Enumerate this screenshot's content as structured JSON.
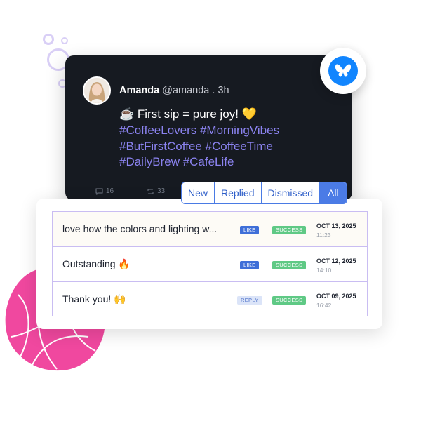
{
  "colors": {
    "card_dark": "#161a21",
    "hashtag": "#8b83f0",
    "accent_blue": "#4b7be6",
    "bluesky": "#1185fe",
    "success": "#5fc985",
    "blob_pink": "#f0489f",
    "table_border": "#c9bdf2"
  },
  "post": {
    "author_name": "Amanda",
    "author_meta": "@amanda . 3h",
    "line1": "☕ First sip = pure joy! 💛",
    "line2": "#CoffeeLovers #MorningVibes",
    "line3": "#ButFirstCoffee #CoffeeTime",
    "line4": "#DailyBrew #CafeLife",
    "comments": "16",
    "reposts": "33",
    "platform_icon": "bluesky-butterfly-icon"
  },
  "tabs": [
    {
      "label": "New"
    },
    {
      "label": "Replied"
    },
    {
      "label": "Dismissed"
    },
    {
      "label": "All",
      "active": true
    }
  ],
  "rows": [
    {
      "message": "love how the colors and lighting w...",
      "type": "LIKE",
      "status": "SUCCESS",
      "date": "OCT 13, 2025",
      "time": "11:23"
    },
    {
      "message": "Outstanding 🔥",
      "type": "LIKE",
      "status": "SUCCESS",
      "date": "OCT 12, 2025",
      "time": "14:10"
    },
    {
      "message": "Thank you! 🙌",
      "type": "REPLY",
      "status": "SUCCESS",
      "date": "OCT 09, 2025",
      "time": "16:42"
    }
  ]
}
